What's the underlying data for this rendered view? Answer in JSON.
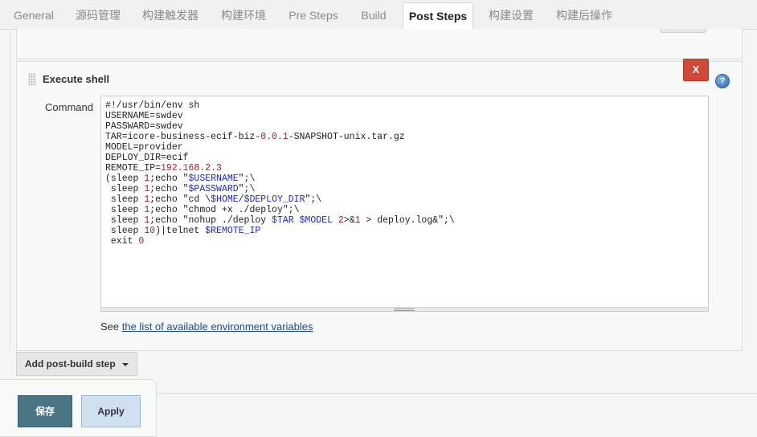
{
  "tabs": [
    {
      "label": "General"
    },
    {
      "label": "源码管理"
    },
    {
      "label": "构建触发器"
    },
    {
      "label": "构建环境"
    },
    {
      "label": "Pre Steps"
    },
    {
      "label": "Build"
    },
    {
      "label": "Post Steps",
      "active": true
    },
    {
      "label": "构建设置"
    },
    {
      "label": "构建后操作"
    }
  ],
  "execute_shell": {
    "title": "Execute shell",
    "close_label": "X",
    "help_label": "?",
    "command_label": "Command",
    "command_lines": [
      "#!/usr/bin/env sh",
      "USERNAME=swdev",
      "PASSWARD=swdev",
      "TAR=icore-business-ecif-biz-0.0.1-SNAPSHOT-unix.tar.gz",
      "MODEL=provider",
      "DEPLOY_DIR=ecif",
      "REMOTE_IP=192.168.2.3",
      "(sleep 1;echo \"$USERNAME\";\\",
      " sleep 1;echo \"$PASSWARD\";\\",
      " sleep 1;echo \"cd \\$HOME/$DEPLOY_DIR\";\\",
      " sleep 1;echo \"chmod +x ./deploy\";\\",
      " sleep 1;echo \"nohup ./deploy $TAR $MODEL 2>&1 > deploy.log&\";\\",
      " sleep 10)|telnet $REMOTE_IP",
      " exit 0"
    ],
    "see_prefix": "See ",
    "env_link_text": "the list of available environment variables"
  },
  "add_step": {
    "label": "Add post-build step"
  },
  "savebar": {
    "save_label": "保存",
    "apply_label": "Apply"
  },
  "colors": {
    "close": "#d24939",
    "save": "#4a7585",
    "apply": "#cfe0f0",
    "link": "#204a87"
  }
}
